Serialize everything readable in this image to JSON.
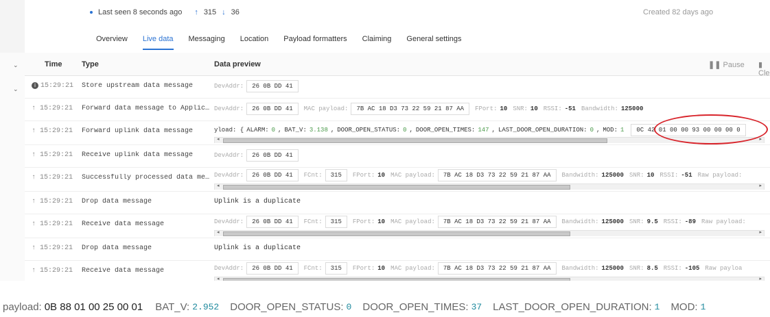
{
  "header": {
    "last_seen": "Last seen 8 seconds ago",
    "uplink_count": "315",
    "downlink_count": "36",
    "created": "Created 82 days ago"
  },
  "tabs": [
    "Overview",
    "Live data",
    "Messaging",
    "Location",
    "Payload formatters",
    "Claiming",
    "General settings"
  ],
  "active_tab": "Live data",
  "table": {
    "col_time": "Time",
    "col_type": "Type",
    "col_preview": "Data preview",
    "pause_label": "Pause",
    "clear_label": "Clear"
  },
  "rows": [
    {
      "time": "15:29:21",
      "type": "Store upstream data message",
      "icon": "info-icon"
    },
    {
      "time": "15:29:21",
      "type": "Forward data message to Applic…",
      "icon": "arrow-up-icon"
    },
    {
      "time": "15:29:21",
      "type": "Forward uplink data message",
      "icon": "arrow-up-icon"
    },
    {
      "time": "15:29:21",
      "type": "Receive uplink data message",
      "icon": "arrow-up-icon"
    },
    {
      "time": "15:29:21",
      "type": "Successfully processed data me…",
      "icon": "arrow-up-icon"
    },
    {
      "time": "15:29:21",
      "type": "Drop data message",
      "icon": "arrow-up-icon"
    },
    {
      "time": "15:29:21",
      "type": "Receive data message",
      "icon": "arrow-up-icon"
    },
    {
      "time": "15:29:21",
      "type": "Drop data message",
      "icon": "arrow-up-icon"
    },
    {
      "time": "15:29:21",
      "type": "Receive data message",
      "icon": "arrow-up-icon"
    }
  ],
  "preview": {
    "devaddr_label": "DevAddr:",
    "devaddr": "26 0B DD 41",
    "mac_label": "MAC payload:",
    "mac_payload": "7B AC 18 D3 73 22 59 21 87 AA",
    "fport_label": "FPort:",
    "fport": "10",
    "snr_label": "SNR:",
    "snr_a": "10",
    "snr_b": "9.5",
    "snr_c": "8.5",
    "rssi_label": "RSSI:",
    "rssi_a": "-51",
    "rssi_b": "-89",
    "rssi_c": "-105",
    "bandwidth_label": "Bandwidth:",
    "bandwidth": "125000",
    "fcnt_label": "FCnt:",
    "fcnt": "315",
    "raw_label_full": "Raw payload:",
    "raw_label_cut": "Raw payloa",
    "duplicate": "Uplink is a duplicate",
    "decoded_prefix": "yload: { ",
    "alarm_key": "ALARM:",
    "alarm": "0",
    "batv_key": "BAT_V:",
    "batv": "3.138",
    "dos_key": "DOOR_OPEN_STATUS:",
    "dos": "0",
    "dot_key": "DOOR_OPEN_TIMES:",
    "dot": "147",
    "ldod_key": "LAST_DOOR_OPEN_DURATION:",
    "ldod": "0",
    "mod_key": "MOD:",
    "mod": "1",
    "raw_hex": "0C 42 01 00 00 93 00 00 00 0"
  },
  "decoded": {
    "payload_key": "payload:",
    "payload_hex": "0B 88 01 00 25 00 01",
    "batv_key": "BAT_V:",
    "batv": "2.952",
    "dos_key": "DOOR_OPEN_STATUS:",
    "dos": "0",
    "dot_key": "DOOR_OPEN_TIMES:",
    "dot": "37",
    "ldod_key": "LAST_DOOR_OPEN_DURATION:",
    "ldod": "1",
    "mod_key": "MOD:",
    "mod": "1"
  },
  "colors": {
    "accent": "#2b73d3",
    "highlight": "#d8232a",
    "decoded_value": "#1f8a9e"
  }
}
